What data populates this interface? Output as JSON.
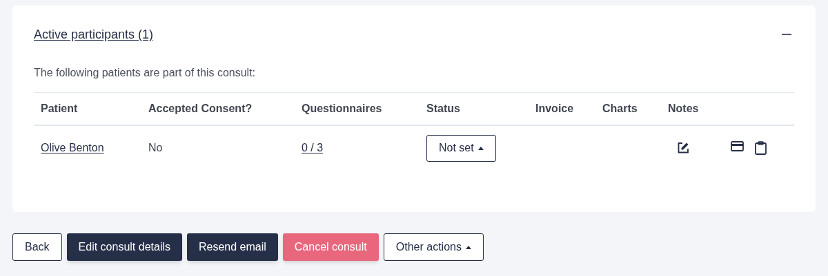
{
  "section": {
    "title": "Active participants (1)",
    "expanded": true,
    "intro": "The following patients are part of this consult:"
  },
  "table": {
    "columns": [
      "Patient",
      "Accepted Consent?",
      "Questionnaires",
      "Status",
      "Invoice",
      "Charts",
      "Notes"
    ],
    "rows": [
      {
        "patient": "Olive Benton",
        "accepted_consent": "No",
        "questionnaires": "0 / 3",
        "status": "Not set"
      }
    ]
  },
  "buttons": [
    {
      "label": "Back",
      "kind": "outline"
    },
    {
      "label": "Edit consult details",
      "kind": "dark"
    },
    {
      "label": "Resend email",
      "kind": "dark"
    },
    {
      "label": "Cancel consult",
      "kind": "danger"
    },
    {
      "label": "Other actions",
      "kind": "dropdown"
    }
  ]
}
